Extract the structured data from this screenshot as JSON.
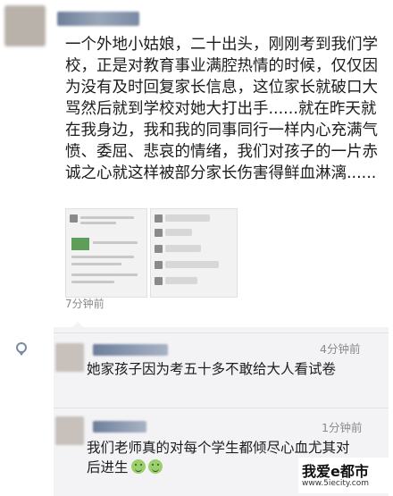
{
  "post": {
    "text": "一个外地小姑娘，二十出头，刚刚考到我们学校，正是对教育事业满腔热情的时候，仅仅因为没有及时回复家长信息，这位家长就破口大骂然后就到学校对她大打出手......就在昨天就在我身边，我和我的同事同行一样内心充满气愤、委屈、悲哀的情绪，我们对孩子的一片赤诚之心就这样被部分家长伤害得鲜血淋漓......",
    "time": "7分钟前"
  },
  "comments": [
    {
      "time": "4分钟前",
      "text": "她家孩子因为考五十多不敢给大人看试卷"
    },
    {
      "time": "1分钟前",
      "text": "我们老师真的对每个学生都倾尽心血尤其对后进生"
    }
  ],
  "watermark": {
    "title": "我爱e都市",
    "url": "www.5iecity.com"
  }
}
